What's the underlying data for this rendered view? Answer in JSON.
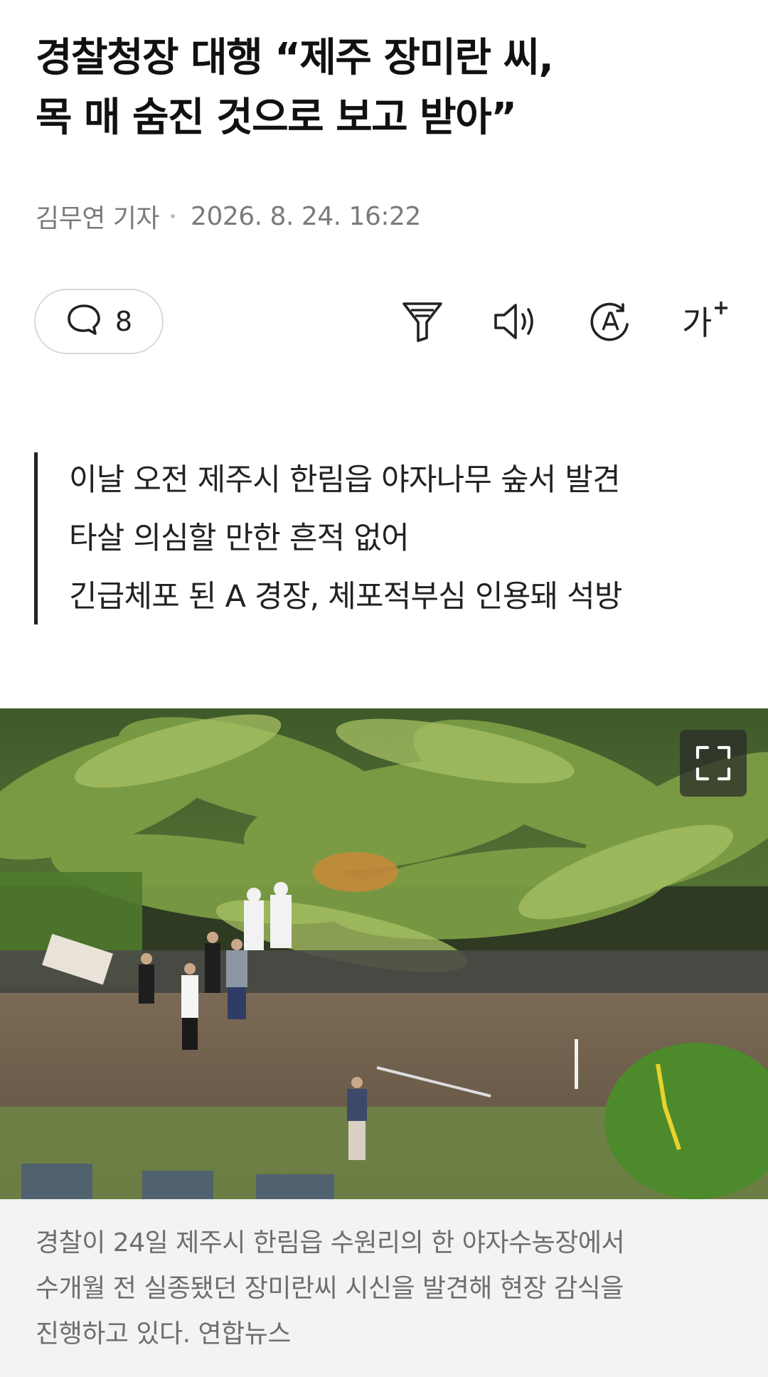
{
  "article": {
    "headline_lines": [
      "경찰청장 대행 “제주 장미란 씨,",
      "목 매 숨진 것으로 보고 받아”"
    ],
    "author": "김무연 기자",
    "timestamp": "2026. 8. 24. 16:22"
  },
  "toolbar": {
    "comment_count": "8",
    "icons": [
      "comment-icon",
      "filter-icon",
      "speaker-icon",
      "translate-icon",
      "font-size-icon"
    ],
    "font_size_label": "가"
  },
  "summary": {
    "lines": [
      "이날 오전 제주시 한림읍 야자나무 숲서 발견",
      "타살 의심할 만한 흔적 없어",
      "긴급체포 된 A 경장, 체포적부심 인용돼 석방"
    ]
  },
  "photo": {
    "expand_icon": "expand-icon",
    "caption_lines": [
      "경찰이 24일 제주시 한림읍 수원리의 한 야자수농장에서",
      "수개월 전 실종됐던 장미란씨 시신을 발견해 현장 감식을",
      "진행하고 있다. 연합뉴스"
    ]
  },
  "colors": {
    "text": "#111111",
    "meta": "#7a7a7a",
    "caption_bg": "#f3f3f3"
  }
}
